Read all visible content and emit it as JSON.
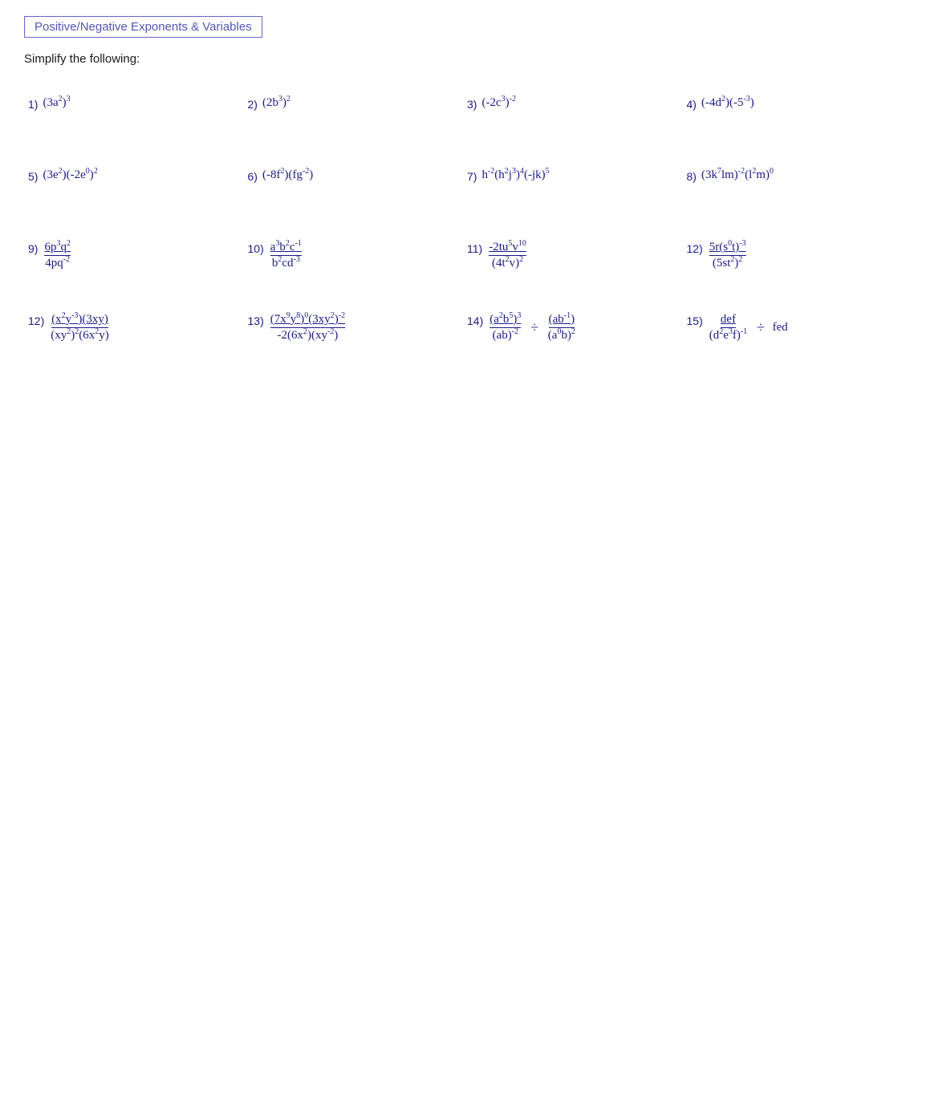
{
  "title": "Positive/Negative Exponents & Variables",
  "instruction": "Simplify the following:",
  "problems": [
    {
      "num": "1)",
      "html": "(3a<sup>2</sup>)<sup>3</sup>"
    },
    {
      "num": "2)",
      "html": "(2b<sup>3</sup>)<sup>2</sup>"
    },
    {
      "num": "3)",
      "html": "(-2c<sup>3</sup>)<sup>-2</sup>"
    },
    {
      "num": "4)",
      "html": "(-4d<sup>2</sup>)(-5<sup>-3</sup>)"
    },
    {
      "num": "5)",
      "html": "(3e<sup>2</sup>)(-2e<sup>0</sup>)<sup>2</sup>"
    },
    {
      "num": "6)",
      "html": "(-8f<sup>2</sup>)(fg<sup>-2</sup>)"
    },
    {
      "num": "7)",
      "html": "h<sup>-2</sup>(h<sup>2</sup>j<sup>3</sup>)<sup>4</sup>(-jk)<sup>5</sup>"
    },
    {
      "num": "8)",
      "html": "(3k<sup>7</sup>lm)<sup>-2</sup>(l<sup>2</sup>m)<sup>0</sup>"
    },
    {
      "num": "9)",
      "fraction": true,
      "num_html": "6p<sup>3</sup>q<sup>2</sup>",
      "den_html": "4pq<sup>-2</sup>"
    },
    {
      "num": "10)",
      "fraction": true,
      "num_html": "a<sup>3</sup>b<sup>2</sup>c<sup>-1</sup>",
      "den_html": "b<sup>2</sup>cd<sup>-3</sup>"
    },
    {
      "num": "11)",
      "fraction": true,
      "num_html": "-2tu<sup>5</sup>v<sup>10</sup>",
      "den_html": "(4t<sup>2</sup>v)<sup>2</sup>"
    },
    {
      "num": "12)",
      "fraction": true,
      "num_html": "5r(s<sup>0</sup>t)<sup>-3</sup>",
      "den_html": "(5st<sup>2</sup>)<sup>2</sup>"
    },
    {
      "num": "12)",
      "fraction": true,
      "num_html": "(x<sup>2</sup>y<sup>-3</sup>)(3xy)",
      "den_html": "(xy<sup>2</sup>)<sup>2</sup>(6x<sup>2</sup>y)"
    },
    {
      "num": "13)",
      "fraction": true,
      "num_html": "(7x<sup>9</sup>y<sup>8</sup>)<sup>0</sup>(3xy<sup>2</sup>)<sup>-2</sup>",
      "den_html": "-2(6x<sup>2</sup>)(xy<sup>-2</sup>)"
    },
    {
      "num": "14)",
      "fraction14": true
    },
    {
      "num": "15)",
      "fraction15": true
    }
  ]
}
